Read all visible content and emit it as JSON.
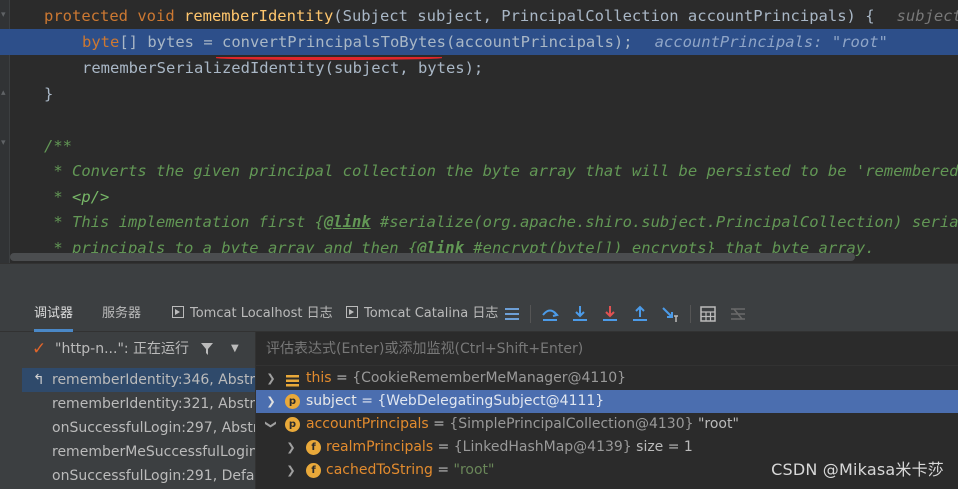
{
  "editor": {
    "line1": {
      "kw": "protected void ",
      "fn": "rememberIdentity",
      "rest": "(Subject subject, PrincipalCollection accountPrincipals) {",
      "hint": "subject"
    },
    "line2": {
      "kw": "byte",
      "mid": "[] bytes = ",
      "fn": "convertPrincipalsToBytes",
      "rest": "(accountPrincipals);",
      "hint": "accountPrincipals: \"root\""
    },
    "line3": {
      "text": "rememberSerializedIdentity(subject, bytes);"
    },
    "line4": {
      "text": "}"
    },
    "line6": {
      "text": "/**"
    },
    "line7": {
      "text": " * Converts the given principal collection the byte array that will be persisted to be 'remembered'"
    },
    "line8": {
      "pre": " * ",
      "tag": "<p/>"
    },
    "line9": {
      "pre": " * This implementation first {",
      "link": "@link",
      "post": " #serialize(org.apache.shiro.subject.PrincipalCollection) serial"
    },
    "line10": {
      "pre": " * principals to a byte array and then {",
      "link": "@link",
      "post": " #encrypt(byte[]) encrypts} that byte array."
    }
  },
  "debug_tabs": {
    "debugger": "调试器",
    "services": "服务器",
    "tomcat_localhost": "Tomcat Localhost 日志",
    "tomcat_catalina": "Tomcat Catalina 日志"
  },
  "frames": {
    "thread": "\"http-n...\": 正在运行",
    "items": [
      "rememberIdentity:346, Abstra",
      "rememberIdentity:321, Abstra",
      "onSuccessfulLogin:297, Abstra",
      "rememberMeSuccessfulLogin:",
      "onSuccessfulLogin:291, Defaul"
    ]
  },
  "variables": {
    "eval_placeholder": "评估表达式(Enter)或添加监视(Ctrl+Shift+Enter)",
    "rows": [
      {
        "name": "this",
        "eq": " = ",
        "value": "{CookieRememberMeManager@4110}"
      },
      {
        "name": "subject",
        "eq": " = ",
        "value": "{WebDelegatingSubject@4111}"
      },
      {
        "name": "accountPrincipals",
        "eq": " = ",
        "value": "{SimplePrincipalCollection@4130}",
        "extra": " \"root\""
      },
      {
        "name": "realmPrincipals",
        "eq": " = ",
        "value": "{LinkedHashMap@4139}",
        "extra": "  size = 1"
      },
      {
        "name": "cachedToString",
        "eq": " = ",
        "value": "\"root\""
      }
    ],
    "badges": {
      "p": "p",
      "f": "f"
    }
  },
  "watermark": "CSDN @Mikasa米卡莎",
  "colors": {
    "editor_bg": "#2b2b2b",
    "current_line": "#2d4f8a",
    "selected_var": "#4b6eaf",
    "keyword": "#cc7832",
    "method": "#ffc66d",
    "doc_comment": "#629755",
    "annotation_underline": "#e0262b"
  },
  "icons": {
    "thread_status": "check-icon",
    "filter": "filter-icon",
    "tomcat_tab": "play-console-icon",
    "toolbar": [
      "menu-icon",
      "step-over-icon",
      "step-into-icon",
      "force-step-into-icon",
      "step-out-icon",
      "run-to-cursor-icon",
      "evaluate-icon",
      "trace-icon"
    ]
  }
}
